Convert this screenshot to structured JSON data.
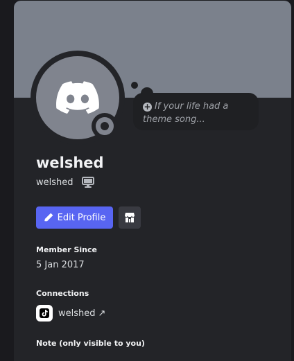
{
  "profile": {
    "display_name": "welshed",
    "username": "welshed",
    "status_bubble_placeholder": "If your life had a theme song...",
    "edit_profile_label": "Edit Profile"
  },
  "member_since": {
    "label": "Member Since",
    "value": "5 Jan 2017"
  },
  "connections": {
    "label": "Connections",
    "items": [
      {
        "service": "tiktok-icon",
        "name": "welshed"
      }
    ]
  },
  "note": {
    "label": "Note (only visible to you)"
  },
  "colors": {
    "banner": "#7b818c",
    "card_bg": "#232428",
    "accent": "#5865f2",
    "avatar_bg": "#80848e"
  }
}
